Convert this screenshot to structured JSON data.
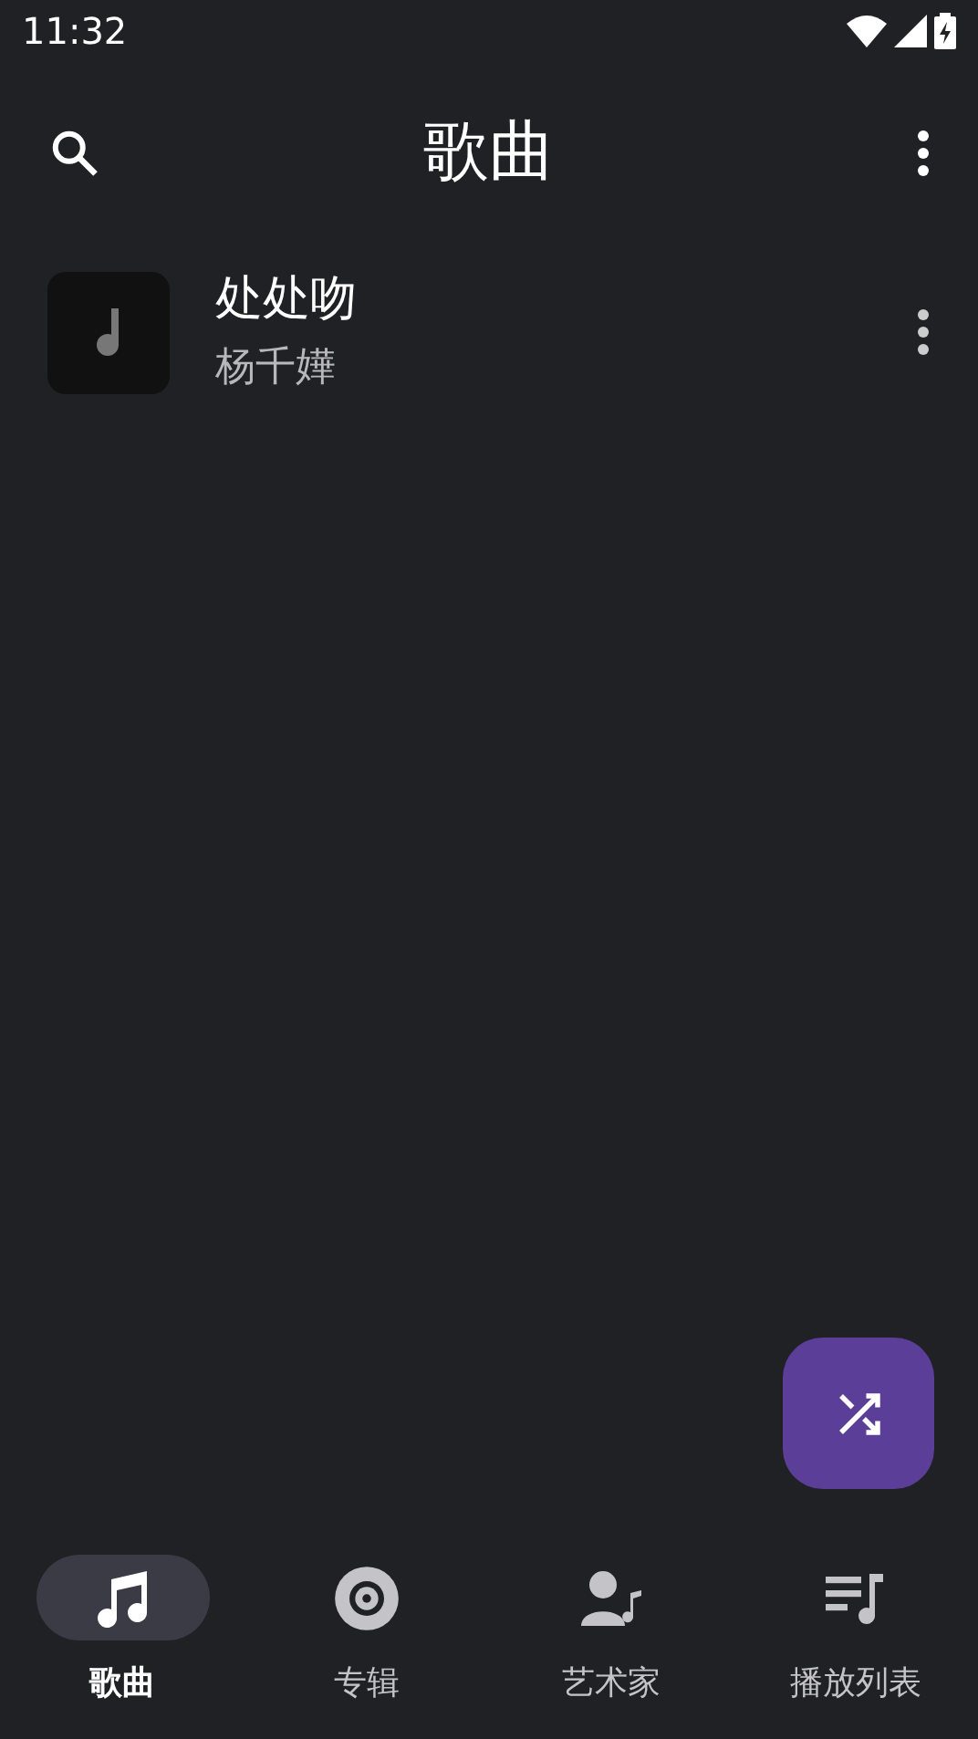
{
  "status_bar": {
    "time": "11:32"
  },
  "top_bar": {
    "title": "歌曲"
  },
  "songs": [
    {
      "title": "处处吻",
      "artist": "杨千嬅"
    }
  ],
  "nav": [
    {
      "label": "歌曲",
      "kind": "songs",
      "selected": true
    },
    {
      "label": "专辑",
      "kind": "albums",
      "selected": false
    },
    {
      "label": "艺术家",
      "kind": "artists",
      "selected": false
    },
    {
      "label": "播放列表",
      "kind": "playlists",
      "selected": false
    }
  ]
}
